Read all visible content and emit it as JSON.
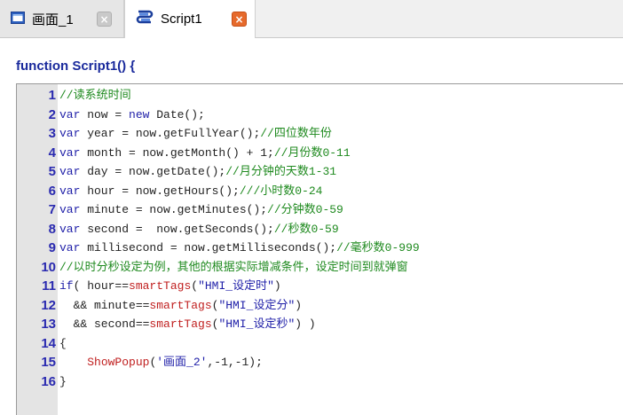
{
  "tabs": [
    {
      "label": "画面_1",
      "icon": "screen-icon",
      "close": "×",
      "active": false
    },
    {
      "label": "Script1",
      "icon": "script-icon",
      "close": "×",
      "active": true
    }
  ],
  "function_header": "function Script1() {",
  "colors": {
    "keyword": "#1f1fa8",
    "comment": "#1f8a1f",
    "function_call": "#c02020",
    "string": "#1f1fa8",
    "line_number": "#2a2ab0"
  },
  "code_lines": [
    {
      "n": "1",
      "tokens": [
        {
          "t": "//读系统时间",
          "c": "cm"
        }
      ]
    },
    {
      "n": "2",
      "tokens": [
        {
          "t": "var",
          "c": "kw"
        },
        {
          "t": " now = ",
          "c": ""
        },
        {
          "t": "new",
          "c": "kw"
        },
        {
          "t": " Date();",
          "c": ""
        }
      ]
    },
    {
      "n": "3",
      "tokens": [
        {
          "t": "var",
          "c": "kw"
        },
        {
          "t": " year = now.getFullYear();",
          "c": ""
        },
        {
          "t": "//四位数年份",
          "c": "cm"
        }
      ]
    },
    {
      "n": "4",
      "tokens": [
        {
          "t": "var",
          "c": "kw"
        },
        {
          "t": " month = now.getMonth() + 1;",
          "c": ""
        },
        {
          "t": "//月份数0-11",
          "c": "cm"
        }
      ]
    },
    {
      "n": "5",
      "tokens": [
        {
          "t": "var",
          "c": "kw"
        },
        {
          "t": " day = now.getDate();",
          "c": ""
        },
        {
          "t": "//月分钟的天数1-31",
          "c": "cm"
        }
      ]
    },
    {
      "n": "6",
      "tokens": [
        {
          "t": "var",
          "c": "kw"
        },
        {
          "t": " hour = now.getHours();",
          "c": ""
        },
        {
          "t": "///小时数0-24",
          "c": "cm"
        }
      ]
    },
    {
      "n": "7",
      "tokens": [
        {
          "t": "var",
          "c": "kw"
        },
        {
          "t": " minute = now.getMinutes();",
          "c": ""
        },
        {
          "t": "//分钟数0-59",
          "c": "cm"
        }
      ]
    },
    {
      "n": "8",
      "tokens": [
        {
          "t": "var",
          "c": "kw"
        },
        {
          "t": " second =  now.getSeconds();",
          "c": ""
        },
        {
          "t": "//秒数0-59",
          "c": "cm"
        }
      ]
    },
    {
      "n": "9",
      "tokens": [
        {
          "t": "var",
          "c": "kw"
        },
        {
          "t": " millisecond = now.getMilliseconds();",
          "c": ""
        },
        {
          "t": "//毫秒数0-999",
          "c": "cm"
        }
      ]
    },
    {
      "n": "10",
      "tokens": [
        {
          "t": "//以时分秒设定为例，其他的根据实际增减条件，设定时间到就弹窗",
          "c": "cm"
        }
      ]
    },
    {
      "n": "11",
      "tokens": [
        {
          "t": "if",
          "c": "kw"
        },
        {
          "t": "( hour==",
          "c": ""
        },
        {
          "t": "smartTags",
          "c": "fn"
        },
        {
          "t": "(",
          "c": ""
        },
        {
          "t": "\"HMI_设定时\"",
          "c": "st"
        },
        {
          "t": ")",
          "c": ""
        }
      ]
    },
    {
      "n": "12",
      "tokens": [
        {
          "t": "  && minute==",
          "c": ""
        },
        {
          "t": "smartTags",
          "c": "fn"
        },
        {
          "t": "(",
          "c": ""
        },
        {
          "t": "\"HMI_设定分\"",
          "c": "st"
        },
        {
          "t": ")",
          "c": ""
        }
      ]
    },
    {
      "n": "13",
      "tokens": [
        {
          "t": "  && second==",
          "c": ""
        },
        {
          "t": "smartTags",
          "c": "fn"
        },
        {
          "t": "(",
          "c": ""
        },
        {
          "t": "\"HMI_设定秒\"",
          "c": "st"
        },
        {
          "t": ") )",
          "c": ""
        }
      ]
    },
    {
      "n": "14",
      "tokens": [
        {
          "t": "{",
          "c": ""
        }
      ]
    },
    {
      "n": "15",
      "tokens": [
        {
          "t": "    ",
          "c": ""
        },
        {
          "t": "ShowPopup",
          "c": "fn"
        },
        {
          "t": "(",
          "c": ""
        },
        {
          "t": "'画面_2'",
          "c": "st"
        },
        {
          "t": ",-1,-1);",
          "c": ""
        }
      ]
    },
    {
      "n": "16",
      "tokens": [
        {
          "t": "}",
          "c": ""
        }
      ]
    }
  ]
}
